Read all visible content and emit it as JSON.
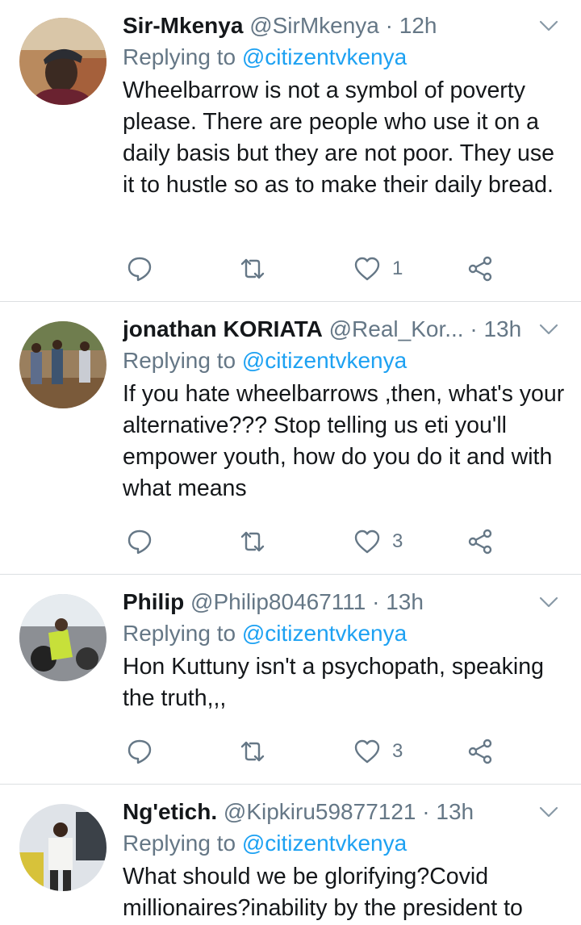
{
  "tweets": [
    {
      "name": "Sir-Mkenya",
      "handle": "@SirMkenya",
      "separator": "·",
      "time": "12h",
      "replying_prefix": "Replying to",
      "replying_to": "@citizentvkenya",
      "text": "Wheelbarrow is not a symbol of poverty please. There are people who use it on a daily basis but they are not poor. They use it to hustle so as to make their daily bread.",
      "likes": "1"
    },
    {
      "name": "jonathan KORIATA",
      "handle": "@Real_Kor...",
      "separator": "·",
      "time": "13h",
      "replying_prefix": "Replying to",
      "replying_to": "@citizentvkenya",
      "text": "If you hate wheelbarrows ,then, what's your alternative??? Stop telling us eti you'll empower youth, how do you do it and with what means",
      "likes": "3"
    },
    {
      "name": "Philip",
      "handle": "@Philip80467111",
      "separator": "·",
      "time": "13h",
      "replying_prefix": "Replying to",
      "replying_to": "@citizentvkenya",
      "text": "Hon Kuttuny isn't a psychopath, speaking the truth,,,",
      "likes": "3"
    },
    {
      "name": "Ng'etich.",
      "handle": "@Kipkiru59877121",
      "separator": "·",
      "time": "13h",
      "replying_prefix": "Replying to",
      "replying_to": "@citizentvkenya",
      "text": "What should we be glorifying?Covid millionaires?inability by the president to",
      "likes": ""
    }
  ],
  "icons": {
    "reply": "reply-icon",
    "retweet": "retweet-icon",
    "like": "heart-icon",
    "share": "share-icon",
    "menu": "chevron-down-icon"
  },
  "colors": {
    "text": "#14171a",
    "secondary": "#657786",
    "link": "#1da1f2",
    "divider": "#dcdfe2"
  }
}
